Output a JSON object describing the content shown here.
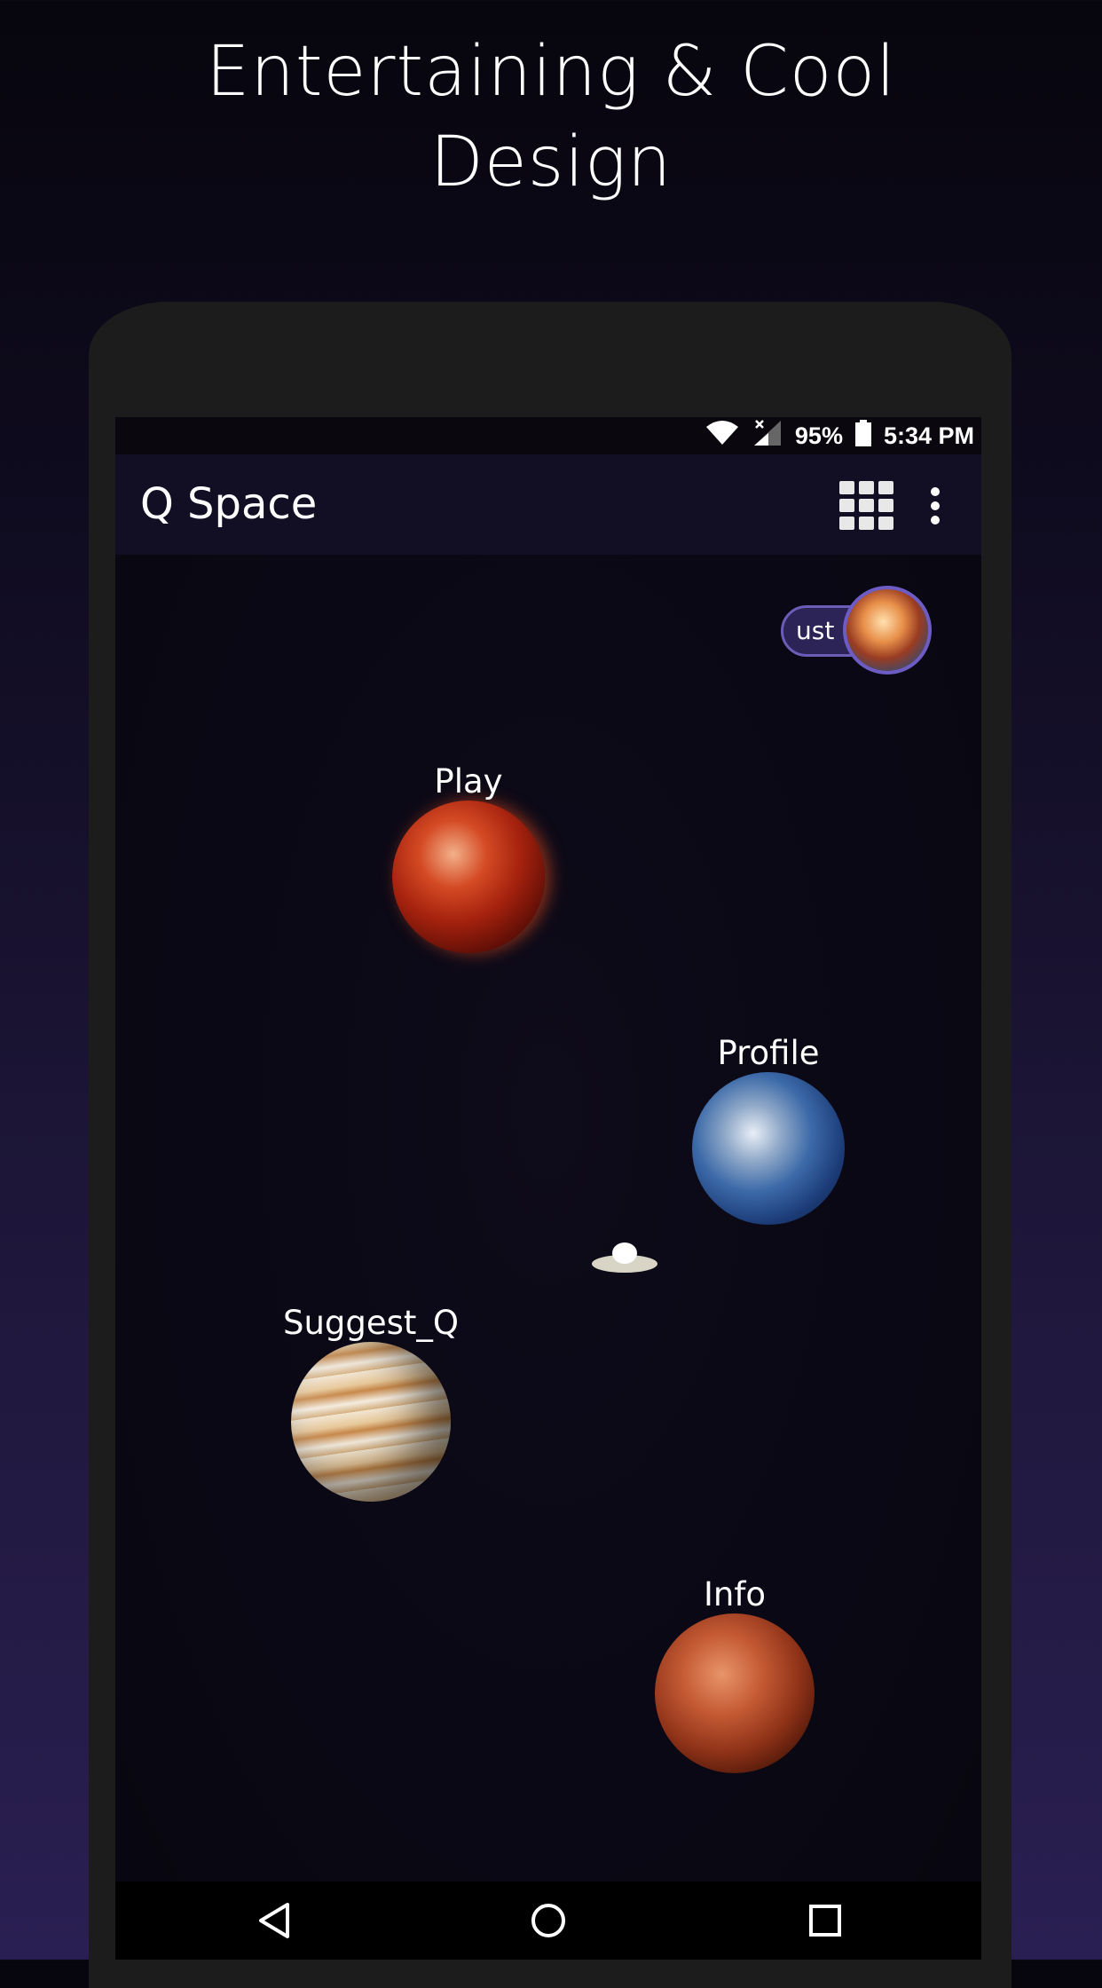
{
  "promo": {
    "headline_line1": "Entertaining & Cool",
    "headline_line2": "Design"
  },
  "statusbar": {
    "battery": "95%",
    "time": "5:34 PM",
    "icons": [
      "wifi-icon",
      "signal-icon",
      "battery-icon"
    ]
  },
  "appbar": {
    "title": "Q Space",
    "actions": [
      "grid-icon",
      "more-vert-icon"
    ]
  },
  "user_chip": {
    "label": "ust",
    "avatar": "avatar"
  },
  "planets": [
    {
      "label": "Play",
      "icon": "red-planet"
    },
    {
      "label": "Profile",
      "icon": "earth"
    },
    {
      "label": "Suggest_Q",
      "icon": "jupiter"
    },
    {
      "label": "Info",
      "icon": "mars"
    }
  ],
  "navbar": {
    "buttons": [
      "back-icon",
      "home-icon",
      "recents-icon"
    ]
  },
  "colors": {
    "appbar_bg": "#120f24",
    "screen_bg": "#0a0814",
    "chip_border": "#6b5cb8",
    "text": "#ffffff"
  }
}
